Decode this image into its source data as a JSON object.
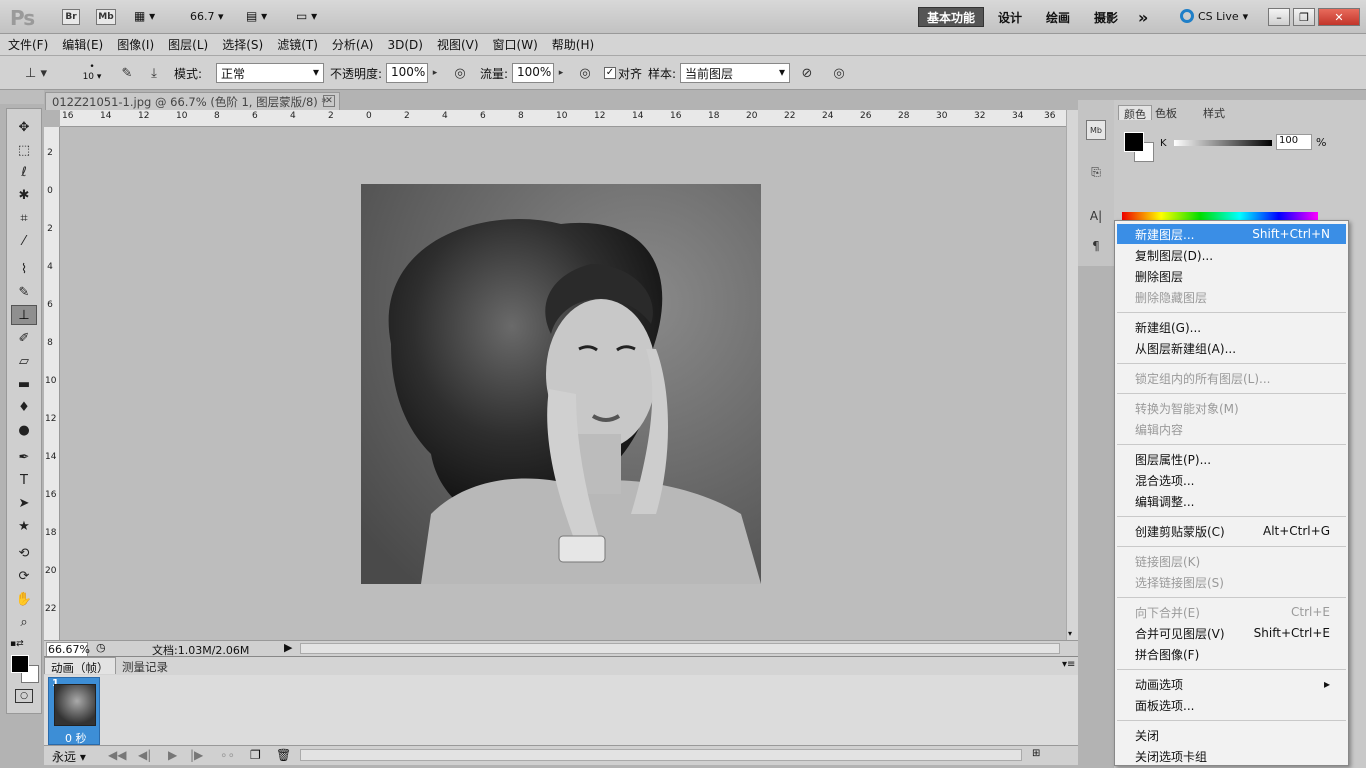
{
  "app": {
    "logo": "Ps",
    "br": "Br",
    "mb": "Mb",
    "zoom": "66.7",
    "workspaces": [
      "基本功能",
      "设计",
      "绘画",
      "摄影"
    ],
    "more": "»",
    "cslive": "CS Live"
  },
  "menu": [
    "文件(F)",
    "编辑(E)",
    "图像(I)",
    "图层(L)",
    "选择(S)",
    "滤镜(T)",
    "分析(A)",
    "3D(D)",
    "视图(V)",
    "窗口(W)",
    "帮助(H)"
  ],
  "options": {
    "brush_size": "10",
    "mode_label": "模式:",
    "mode_value": "正常",
    "opacity_label": "不透明度:",
    "opacity_value": "100%",
    "flow_label": "流量:",
    "flow_value": "100%",
    "align_label": "对齐",
    "sample_label": "样本:",
    "sample_value": "当前图层"
  },
  "document": {
    "tab_title": "012Z21051-1.jpg @ 66.7% (色阶 1, 图层蒙版/8) *",
    "close": "✕"
  },
  "ruler_top": [
    "16",
    "14",
    "12",
    "10",
    "8",
    "6",
    "4",
    "2",
    "0",
    "2",
    "4",
    "6",
    "8",
    "10",
    "12",
    "14",
    "16",
    "18",
    "20",
    "22",
    "24",
    "26",
    "28",
    "30",
    "32",
    "34",
    "36"
  ],
  "ruler_left": [
    "2",
    "0",
    "2",
    "4",
    "6",
    "8",
    "10",
    "12",
    "14",
    "16",
    "18",
    "20",
    "22"
  ],
  "status": {
    "zoom": "66.67%",
    "doc": "文档:1.03M/2.06M"
  },
  "anim": {
    "tabs": [
      "动画（帧）",
      "测量记录"
    ],
    "frame_num": "1",
    "frame_time": "0 秒",
    "loop": "永远"
  },
  "color_panel": {
    "tabs": [
      "颜色",
      "色板",
      "样式"
    ],
    "channel": "K",
    "value": "100",
    "unit": "%"
  },
  "context_menu": [
    {
      "label": "新建图层...",
      "shortcut": "Shift+Ctrl+N",
      "state": "highlight"
    },
    {
      "label": "复制图层(D)...",
      "shortcut": "",
      "state": "normal"
    },
    {
      "label": "删除图层",
      "shortcut": "",
      "state": "normal"
    },
    {
      "label": "删除隐藏图层",
      "shortcut": "",
      "state": "disabled"
    },
    {
      "sep": true
    },
    {
      "label": "新建组(G)...",
      "shortcut": "",
      "state": "normal"
    },
    {
      "label": "从图层新建组(A)...",
      "shortcut": "",
      "state": "normal"
    },
    {
      "sep": true
    },
    {
      "label": "锁定组内的所有图层(L)...",
      "shortcut": "",
      "state": "disabled"
    },
    {
      "sep": true
    },
    {
      "label": "转换为智能对象(M)",
      "shortcut": "",
      "state": "disabled"
    },
    {
      "label": "编辑内容",
      "shortcut": "",
      "state": "disabled"
    },
    {
      "sep": true
    },
    {
      "label": "图层属性(P)...",
      "shortcut": "",
      "state": "normal"
    },
    {
      "label": "混合选项...",
      "shortcut": "",
      "state": "normal"
    },
    {
      "label": "编辑调整...",
      "shortcut": "",
      "state": "normal"
    },
    {
      "sep": true
    },
    {
      "label": "创建剪贴蒙版(C)",
      "shortcut": "Alt+Ctrl+G",
      "state": "normal"
    },
    {
      "sep": true
    },
    {
      "label": "链接图层(K)",
      "shortcut": "",
      "state": "disabled"
    },
    {
      "label": "选择链接图层(S)",
      "shortcut": "",
      "state": "disabled"
    },
    {
      "sep": true
    },
    {
      "label": "向下合并(E)",
      "shortcut": "Ctrl+E",
      "state": "disabled"
    },
    {
      "label": "合并可见图层(V)",
      "shortcut": "Shift+Ctrl+E",
      "state": "normal"
    },
    {
      "label": "拼合图像(F)",
      "shortcut": "",
      "state": "normal"
    },
    {
      "sep": true
    },
    {
      "label": "动画选项",
      "shortcut": "▸",
      "state": "normal"
    },
    {
      "label": "面板选项...",
      "shortcut": "",
      "state": "normal"
    },
    {
      "sep": true
    },
    {
      "label": "关闭",
      "shortcut": "",
      "state": "normal"
    },
    {
      "label": "关闭选项卡组",
      "shortcut": "",
      "state": "normal"
    }
  ]
}
